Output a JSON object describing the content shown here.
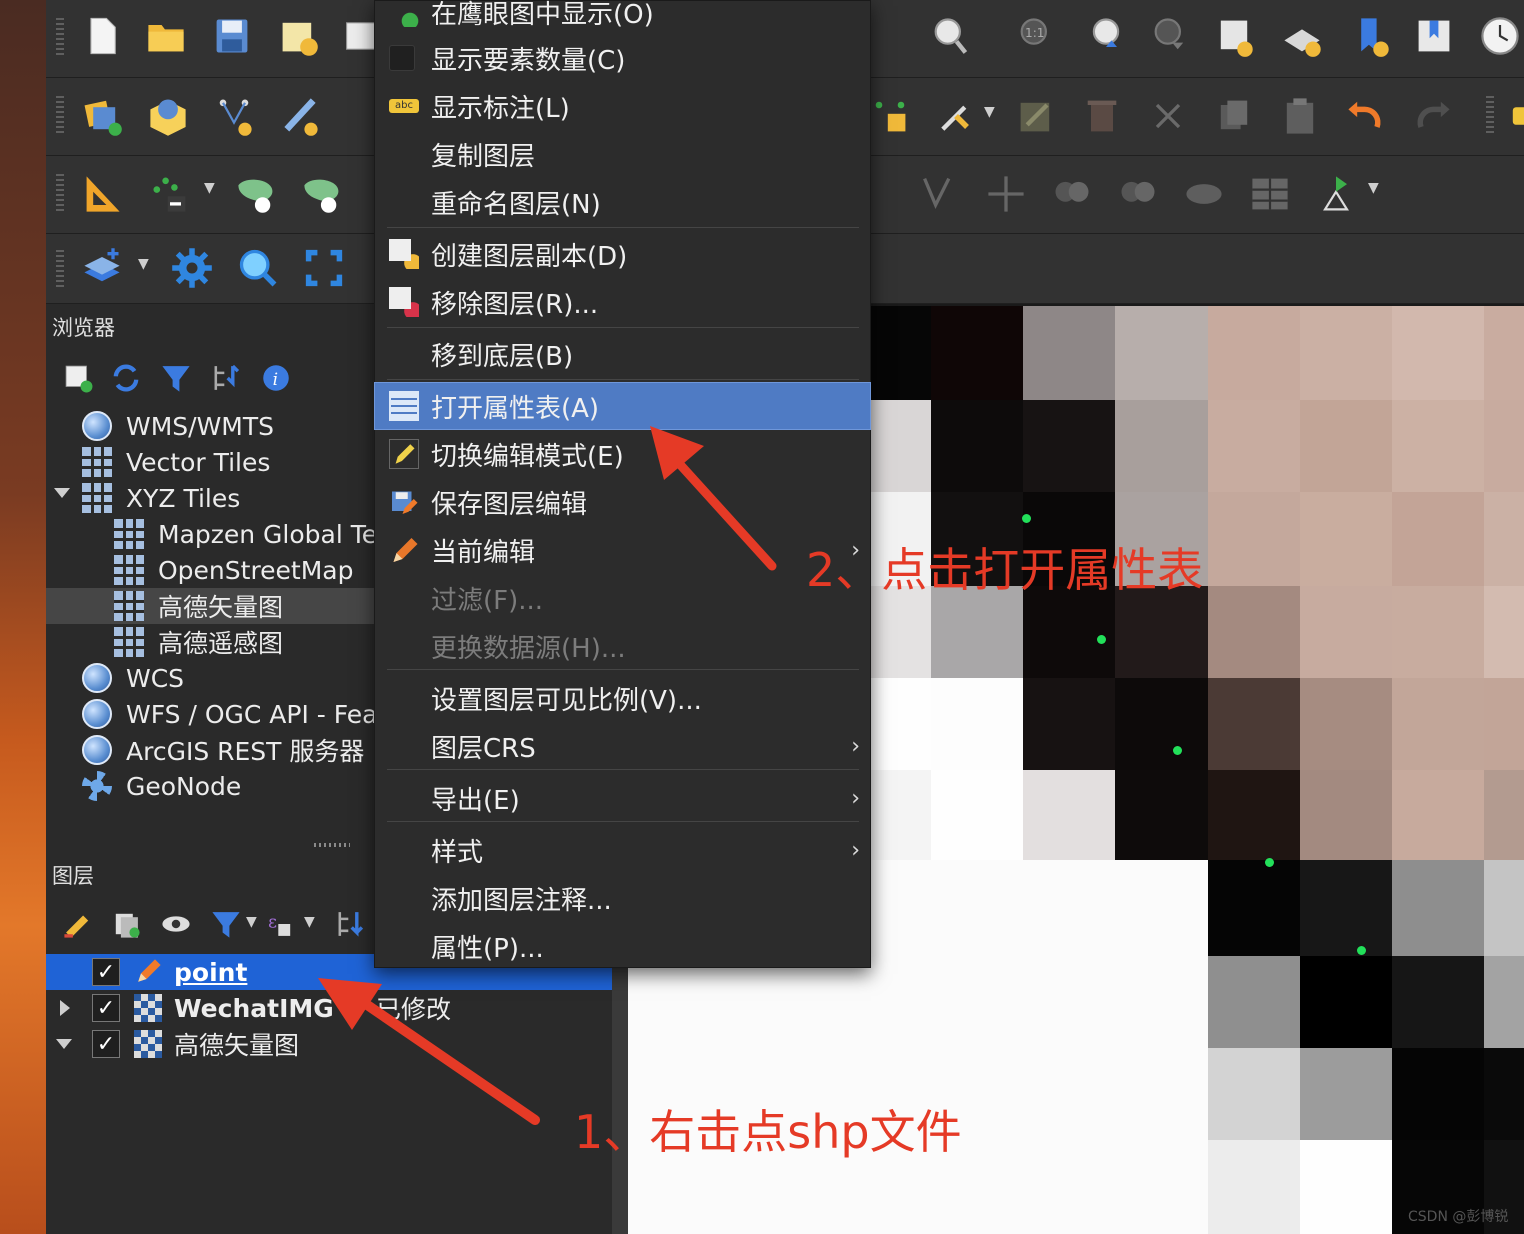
{
  "context_menu": {
    "items": [
      {
        "label": "在鹰眼图中显示(O)",
        "icon": "overview-icon"
      },
      {
        "label": "显示要素数量(C)",
        "icon": "checkbox-icon"
      },
      {
        "label": "显示标注(L)",
        "icon": "label-abc-icon"
      },
      {
        "label": "复制图层",
        "icon": ""
      },
      {
        "label": "重命名图层(N)",
        "icon": ""
      },
      {
        "label": "创建图层副本(D)",
        "icon": "duplicate-layer-icon"
      },
      {
        "label": "移除图层(R)...",
        "icon": "remove-layer-icon"
      },
      {
        "label": "移到底层(B)",
        "icon": ""
      },
      {
        "label": "打开属性表(A)",
        "icon": "attribute-table-icon"
      },
      {
        "label": "切换编辑模式(E)",
        "icon": "pencil-icon"
      },
      {
        "label": "保存图层编辑",
        "icon": "save-edits-icon"
      },
      {
        "label": "当前编辑",
        "icon": "edit-pencil-icon"
      },
      {
        "label": "过滤(F)...",
        "icon": ""
      },
      {
        "label": "更换数据源(H)...",
        "icon": ""
      },
      {
        "label": "设置图层可见比例(V)...",
        "icon": ""
      },
      {
        "label": "图层CRS",
        "icon": ""
      },
      {
        "label": "导出(E)",
        "icon": ""
      },
      {
        "label": "样式",
        "icon": ""
      },
      {
        "label": "添加图层注释...",
        "icon": ""
      },
      {
        "label": "属性(P)...",
        "icon": ""
      }
    ],
    "selected_index": 8,
    "submenu_arrow": "›"
  },
  "browser_panel": {
    "title": "浏览器",
    "items": [
      {
        "label": "WMS/WMTS",
        "icon": "globe-icon"
      },
      {
        "label": "Vector Tiles",
        "icon": "grid-icon"
      },
      {
        "label": "XYZ Tiles",
        "icon": "grid-icon",
        "expanded": true
      },
      {
        "label": "Mapzen Global Te",
        "icon": "grid-icon"
      },
      {
        "label": "OpenStreetMap",
        "icon": "grid-icon"
      },
      {
        "label": "高德矢量图",
        "icon": "grid-icon",
        "selected": true
      },
      {
        "label": "高德遥感图",
        "icon": "grid-icon"
      },
      {
        "label": "WCS",
        "icon": "globe-icon"
      },
      {
        "label": "WFS / OGC API - Fea",
        "icon": "globe-icon"
      },
      {
        "label": "ArcGIS REST 服务器",
        "icon": "globe-icon"
      },
      {
        "label": "GeoNode",
        "icon": "geonode-icon"
      }
    ]
  },
  "layers_panel": {
    "title": "图层",
    "layers": [
      {
        "name": "point",
        "checked_mark": "✓",
        "editing": true,
        "selected": true
      },
      {
        "name": "WechatIMG",
        "checked_mark": "✓",
        "suffix": "已修改"
      },
      {
        "name": "高德矢量图",
        "checked_mark": "✓"
      }
    ]
  },
  "annotations": {
    "step1": "1、右击点shp文件",
    "step2": "2、点击打开属性表"
  },
  "watermark": "CSDN @彭博锐",
  "colors": {
    "accent": "#4f7bc4",
    "annotation": "#e53a26",
    "layer_selected": "#1f63d6",
    "point_marker": "#22e05a"
  }
}
